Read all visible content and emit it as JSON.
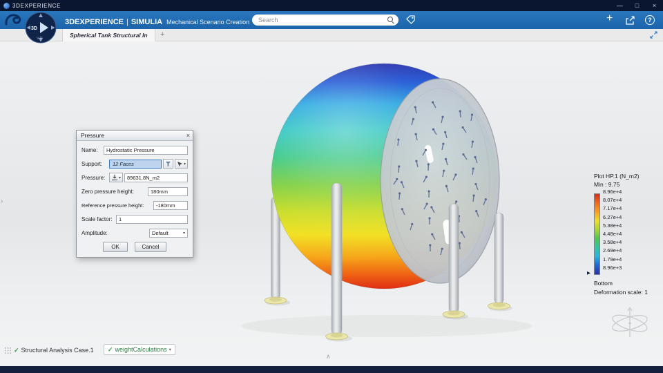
{
  "titlebar": {
    "app_name": "3DEXPERIENCE",
    "minimize": "—",
    "maximize": "□",
    "close": "×"
  },
  "header": {
    "brand": "3DEXPERIENCE",
    "divider": "|",
    "suite": "SIMULIA",
    "module": "Mechanical Scenario Creation",
    "search_placeholder": "Search",
    "add_button": "+",
    "help": "?"
  },
  "compass": {
    "text_3d": "3D",
    "play": "▶",
    "version": "V.R"
  },
  "tabs": {
    "active_title": "Spherical Tank Structural In",
    "new_tab": "+"
  },
  "dialog": {
    "title": "Pressure",
    "close": "×",
    "name_label": "Name:",
    "name_value": "Hydrostatic Pressure",
    "support_label": "Support:",
    "support_value": "12 Faces",
    "pressure_label": "Pressure:",
    "pressure_value": "89631.8N_m2",
    "zero_height_label": "Zero pressure height:",
    "zero_height_value": "180mm",
    "ref_height_label": "Reference pressure height:",
    "ref_height_value": "-180mm",
    "scale_label": "Scale factor:",
    "scale_value": "1",
    "amplitude_label": "Amplitude:",
    "amplitude_value": "Default",
    "ok_label": "OK",
    "cancel_label": "Cancel"
  },
  "legend": {
    "title": "Plot HP.1 (N_m2)",
    "min_label": "Min : 9.75",
    "ticks": [
      "8.96e+4",
      "8.07e+4",
      "7.17e+4",
      "6.27e+4",
      "5.38e+4",
      "4.48e+4",
      "3.58e+4",
      "2.69e+4",
      "1.79e+4",
      "8.96e+3"
    ],
    "marker": "▶",
    "bottom_label": "Bottom",
    "deformation_label": "Deformation scale: 1",
    "colors_top_to_bottom": [
      "#e02a12",
      "#f5691a",
      "#f9a21a",
      "#f2e01e",
      "#a8d62e",
      "#4cc84e",
      "#2fc9a0",
      "#25b6e0",
      "#1d65d6",
      "#2733ae"
    ]
  },
  "status": {
    "check": "✓",
    "case_label": "Structural Analysis Case.1",
    "weight_label": "weightCalculations",
    "caret": "▾"
  },
  "viewport": {
    "left_panel_chevron": "›",
    "bottom_chevron": "∧"
  },
  "icons": {
    "caret": "▾",
    "search": "magnifier",
    "tag": "tag",
    "share": "share-arrow",
    "expand": "expand-arrows"
  },
  "colors": {
    "header_blue": "#1e6cb3",
    "titlebar_navy": "#0a1630",
    "footer_navy": "#14203d",
    "selection_blue": "#bdd4ee",
    "check_green": "#2f9e44"
  }
}
